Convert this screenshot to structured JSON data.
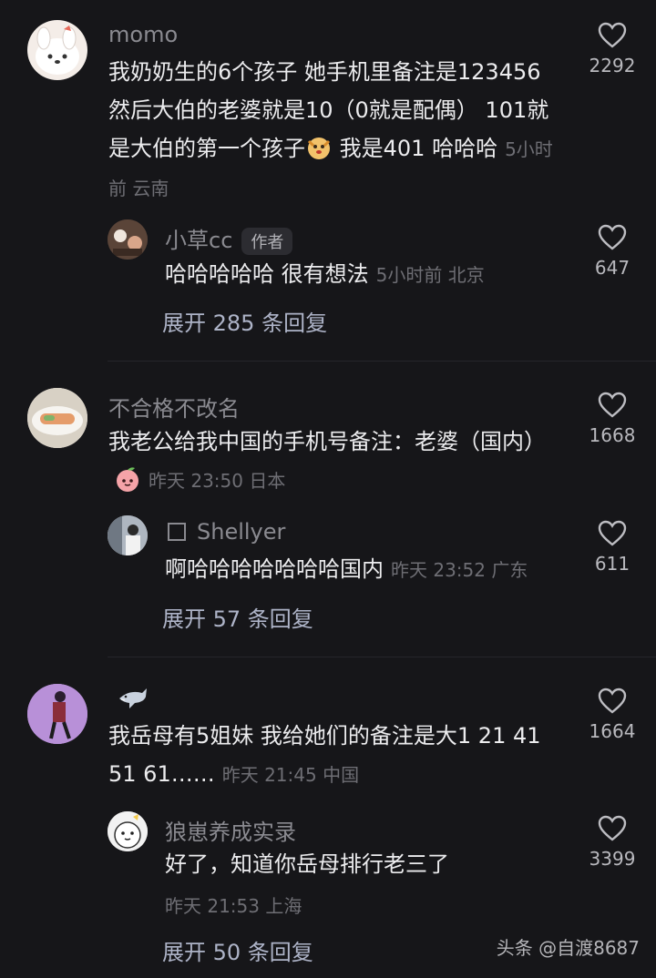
{
  "comments": [
    {
      "name": "momo",
      "body": "我奶奶生的6个孩子  她手机里备注是123456    然后大伯的老婆就是10（0就是配偶）   101就是大伯的第一个孩子",
      "body_after_emoji": " 我是401 哈哈哈",
      "emoji_icon": "puppy-face-emoji",
      "meta": "5小时前 云南",
      "likes": "2292",
      "reply": {
        "name": "小草cc",
        "badge": "作者",
        "body": "哈哈哈哈哈 很有想法",
        "meta": "5小时前 北京",
        "likes": "647"
      },
      "expand": "展开 285 条回复"
    },
    {
      "name": "不合格不改名",
      "body": "我老公给我中国的手机号备注：老婆（国内）",
      "emoji_icon": "peach-face-emoji",
      "meta": "昨天 23:50 日本",
      "likes": "1668",
      "reply": {
        "name": "Shellyer",
        "body": "啊哈哈哈哈哈哈哈国内",
        "meta": "昨天 23:52 广东",
        "likes": "611"
      },
      "expand": "展开 57 条回复"
    },
    {
      "name_icon": "shark-icon",
      "body": "我岳母有5姐妹 我给她们的备注是大1 21 41 51 61……",
      "meta": "昨天 21:45 中国",
      "likes": "1664",
      "reply": {
        "name": "狼崽养成实录",
        "body": "好了，知道你岳母排行老三了",
        "meta": "昨天 21:53 上海",
        "likes": "3399"
      },
      "expand": "展开 50 条回复"
    }
  ],
  "watermark": "头条 @自渡8687"
}
